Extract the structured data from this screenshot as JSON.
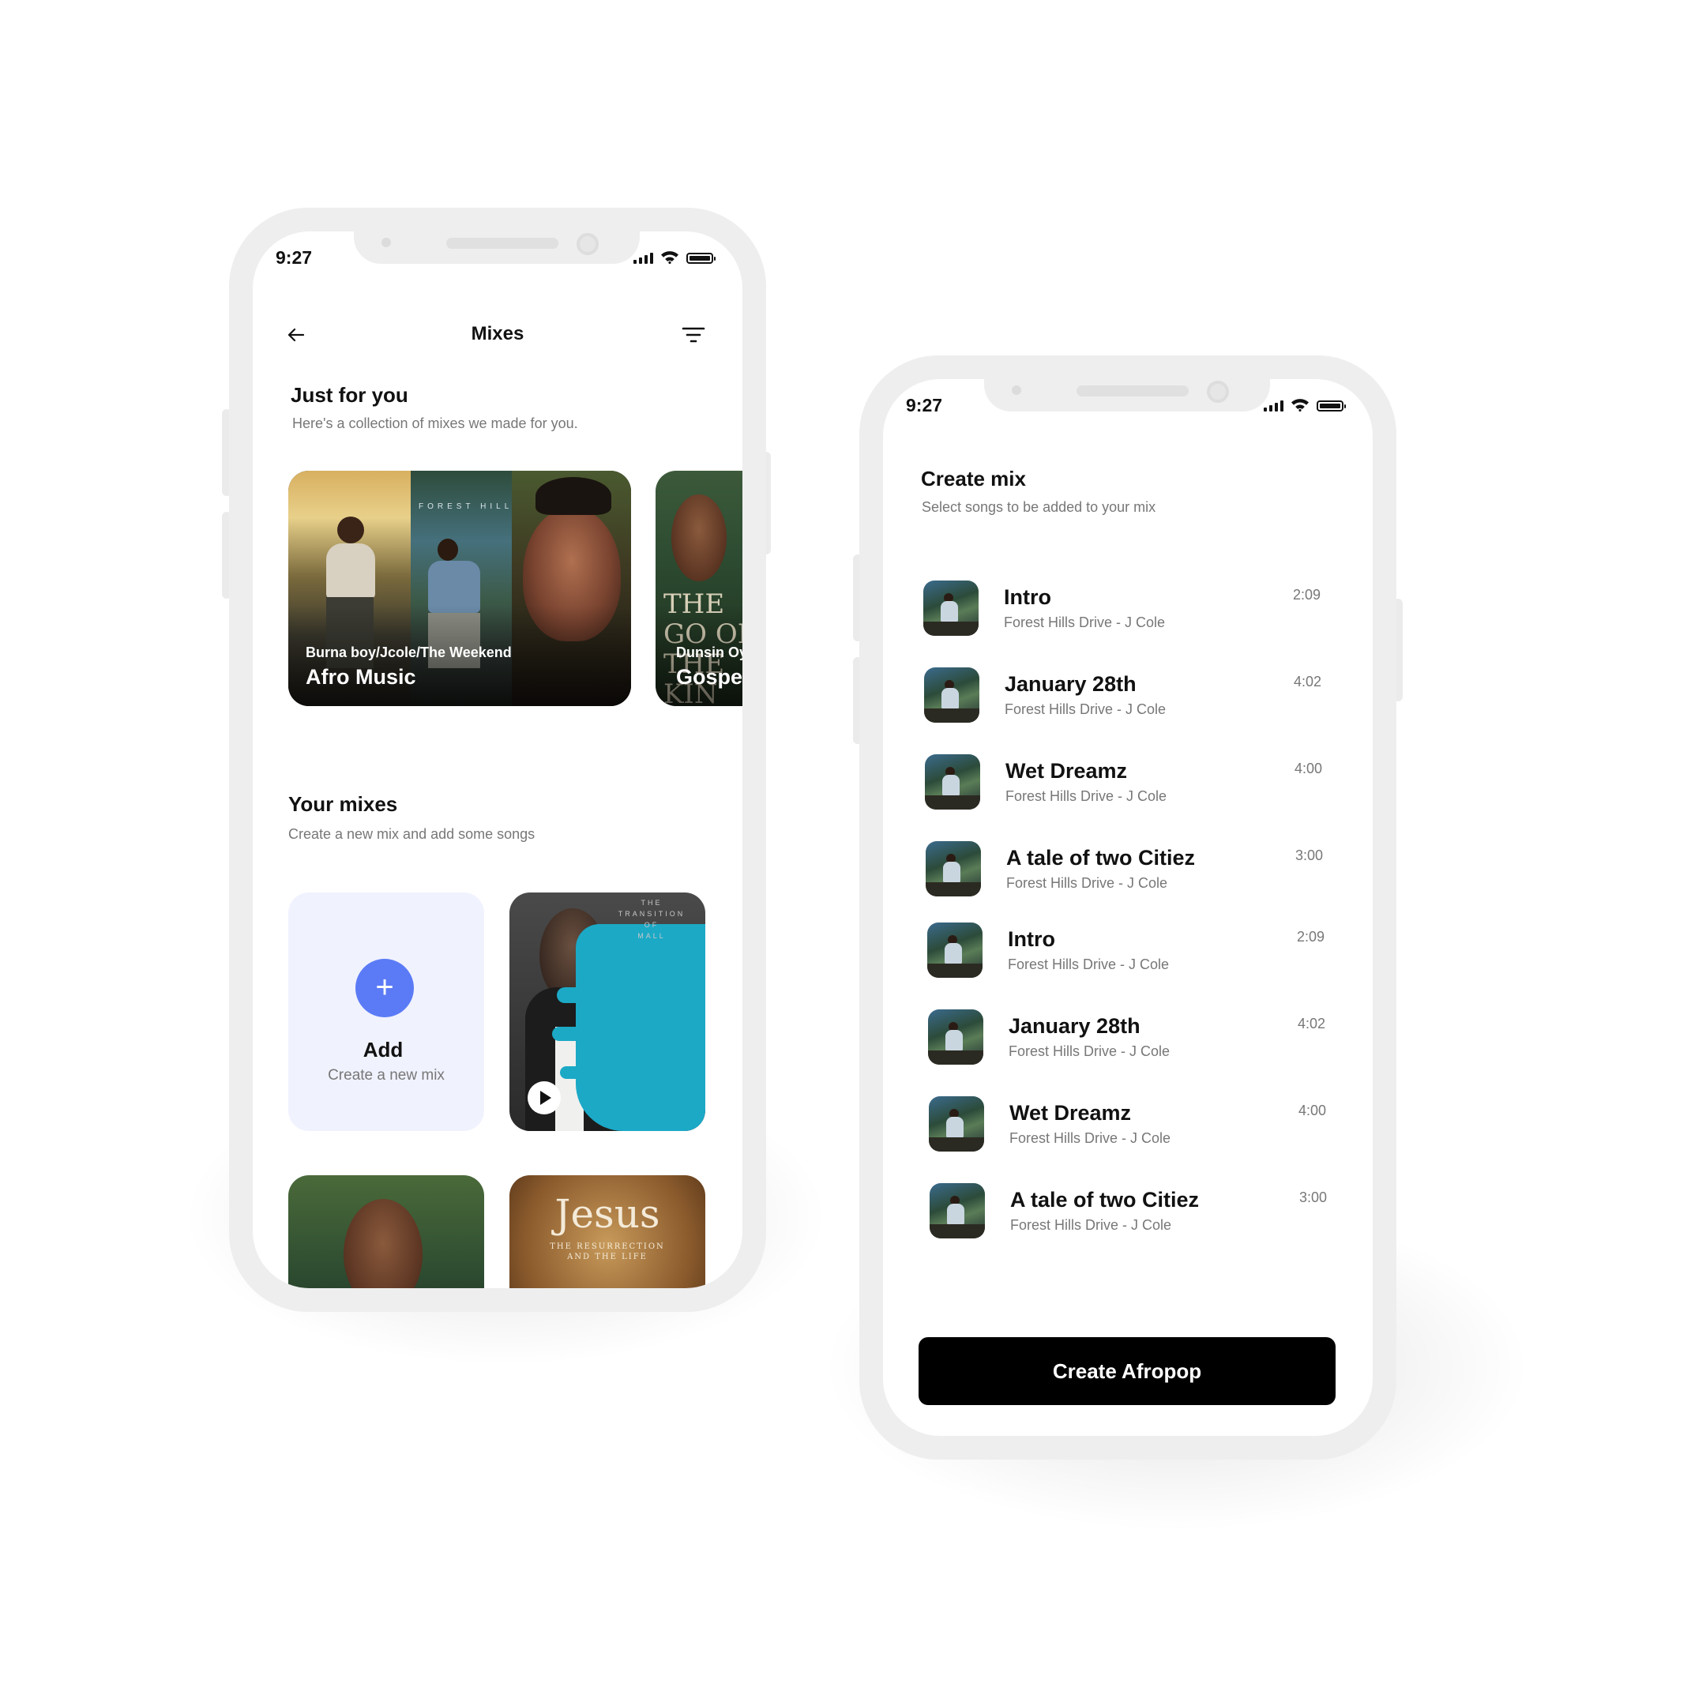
{
  "phone_left": {
    "status": {
      "time": "9:27"
    },
    "header": {
      "title": "Mixes"
    },
    "just_for_you": {
      "title": "Just for you",
      "subtitle": "Here's a collection of mixes we made for you.",
      "cards": [
        {
          "artists": "Burna boy/Jcole/The Weekend",
          "title": "Afro Music",
          "art_text": "FOREST HILLS"
        },
        {
          "artists": "Dunsin Oy",
          "title": "Gospe",
          "art_text": "THE GO OF THE KIN"
        }
      ]
    },
    "your_mixes": {
      "title": "Your mixes",
      "subtitle": "Create a new mix and add some songs",
      "add_card": {
        "icon": "+",
        "label": "Add",
        "sublabel": "Create a new mix"
      },
      "art_text": [
        "THE",
        "TRANSITION",
        "OF",
        "MALL"
      ],
      "jesus_title": "Jesus",
      "jesus_sub": "THE RESURRECTION AND THE LIFE"
    }
  },
  "phone_right": {
    "status": {
      "time": "9:27"
    },
    "create_mix": {
      "title": "Create mix",
      "subtitle": "Select songs to be added to your mix"
    },
    "songs": [
      {
        "title": "Intro",
        "artist": "Forest Hills Drive - J Cole",
        "duration": "2:09"
      },
      {
        "title": "January 28th",
        "artist": "Forest Hills Drive - J Cole",
        "duration": "4:02"
      },
      {
        "title": "Wet Dreamz",
        "artist": "Forest Hills Drive - J Cole",
        "duration": "4:00"
      },
      {
        "title": "A tale of two Citiez",
        "artist": "Forest Hills Drive - J Cole",
        "duration": "3:00"
      },
      {
        "title": "Intro",
        "artist": "Forest Hills Drive - J Cole",
        "duration": "2:09"
      },
      {
        "title": "January 28th",
        "artist": "Forest Hills Drive - J Cole",
        "duration": "4:02"
      },
      {
        "title": "Wet Dreamz",
        "artist": "Forest Hills Drive - J Cole",
        "duration": "4:00"
      },
      {
        "title": "A tale of two Citiez",
        "artist": "Forest Hills Drive - J Cole",
        "duration": "3:00"
      }
    ],
    "cta": {
      "label": "Create Afropop"
    }
  },
  "colors": {
    "accent": "#5b7bf6",
    "add_card_bg": "#f0f2fe",
    "cta_bg": "#000000",
    "frame": "#eeeeee"
  }
}
